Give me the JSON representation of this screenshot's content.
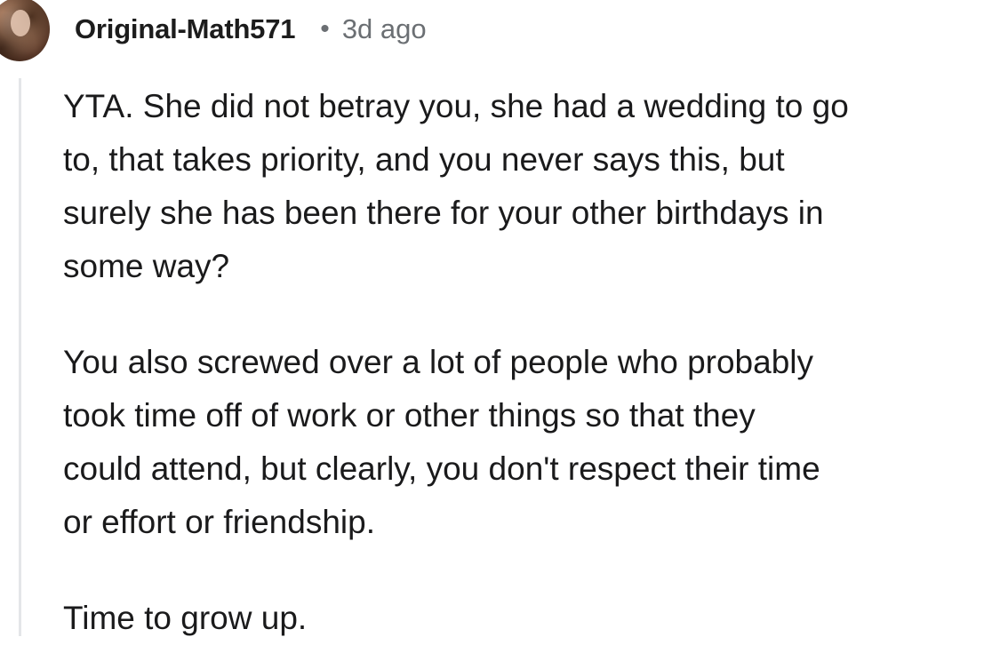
{
  "comment": {
    "author": "Original-Math571",
    "separator": "•",
    "timestamp": "3d ago",
    "paragraphs": [
      {
        "lines": [
          "YTA. She did not betray you, she had a wedding to go",
          "to, that takes priority, and you never says this, but",
          "surely she has been there for your other birthdays in",
          "some way?"
        ]
      },
      {
        "lines": [
          "You also screwed over a lot of people who probably",
          "took time off of work or other things so that they",
          "could attend, but clearly, you don't respect their time",
          "or effort or friendship."
        ]
      },
      {
        "lines": [
          "Time to grow up."
        ]
      }
    ]
  }
}
